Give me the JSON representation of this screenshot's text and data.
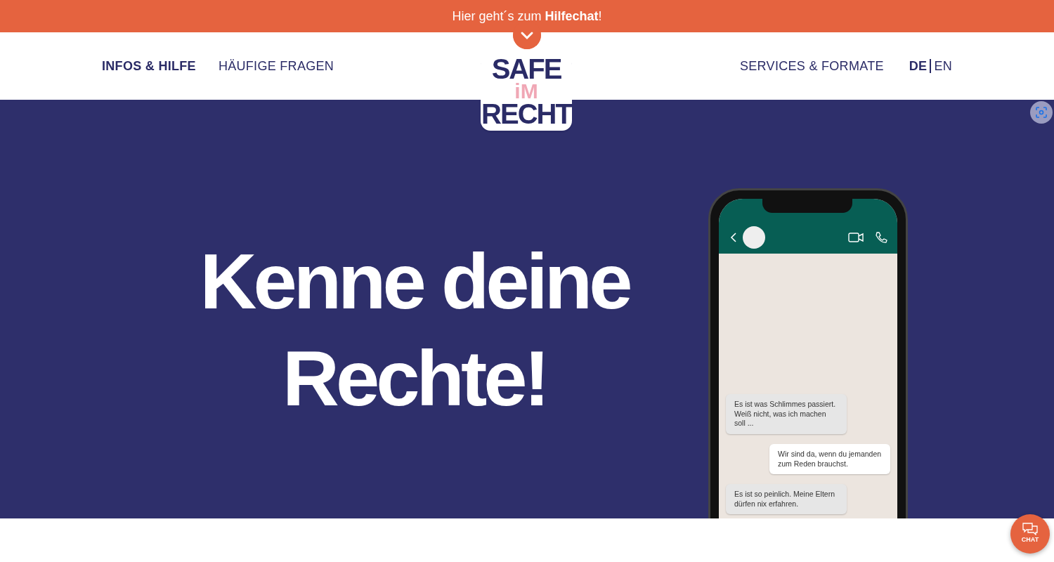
{
  "top_banner": {
    "text": "Hier geht´s zum **Hilfechat**!"
  },
  "nav_left": [
    {
      "label": "INFOS & HILFE",
      "selected": true
    },
    {
      "label": "HÄUFIGE FRAGEN",
      "selected": false
    }
  ],
  "logo": {
    "line_1": "SAFE",
    "line_2": "iM",
    "line_3": "RECHT"
  },
  "nav_right": [
    {
      "label": "SERVICES & FORMATE",
      "selected": false
    }
  ],
  "languages": [
    {
      "label": "DE",
      "selected": true
    },
    {
      "label": "EN",
      "selected": false
    }
  ],
  "hero": {
    "headline_line_1": "Kenne deine",
    "headline_line_2": "Rechte!"
  },
  "chat_preview": {
    "messages": [
      {
        "kind": "incoming",
        "text": "Es ist was Schlimmes passiert. Weiß nicht, was ich machen soll ..."
      },
      {
        "kind": "outgoing",
        "text": "Wir sind da, wenn du jemanden zum Reden brauchst."
      },
      {
        "kind": "incoming",
        "text": "Es ist so peinlich. Meine Eltern dürfen nix erfahren."
      }
    ]
  },
  "chat_button": {
    "label": "CHAT"
  }
}
